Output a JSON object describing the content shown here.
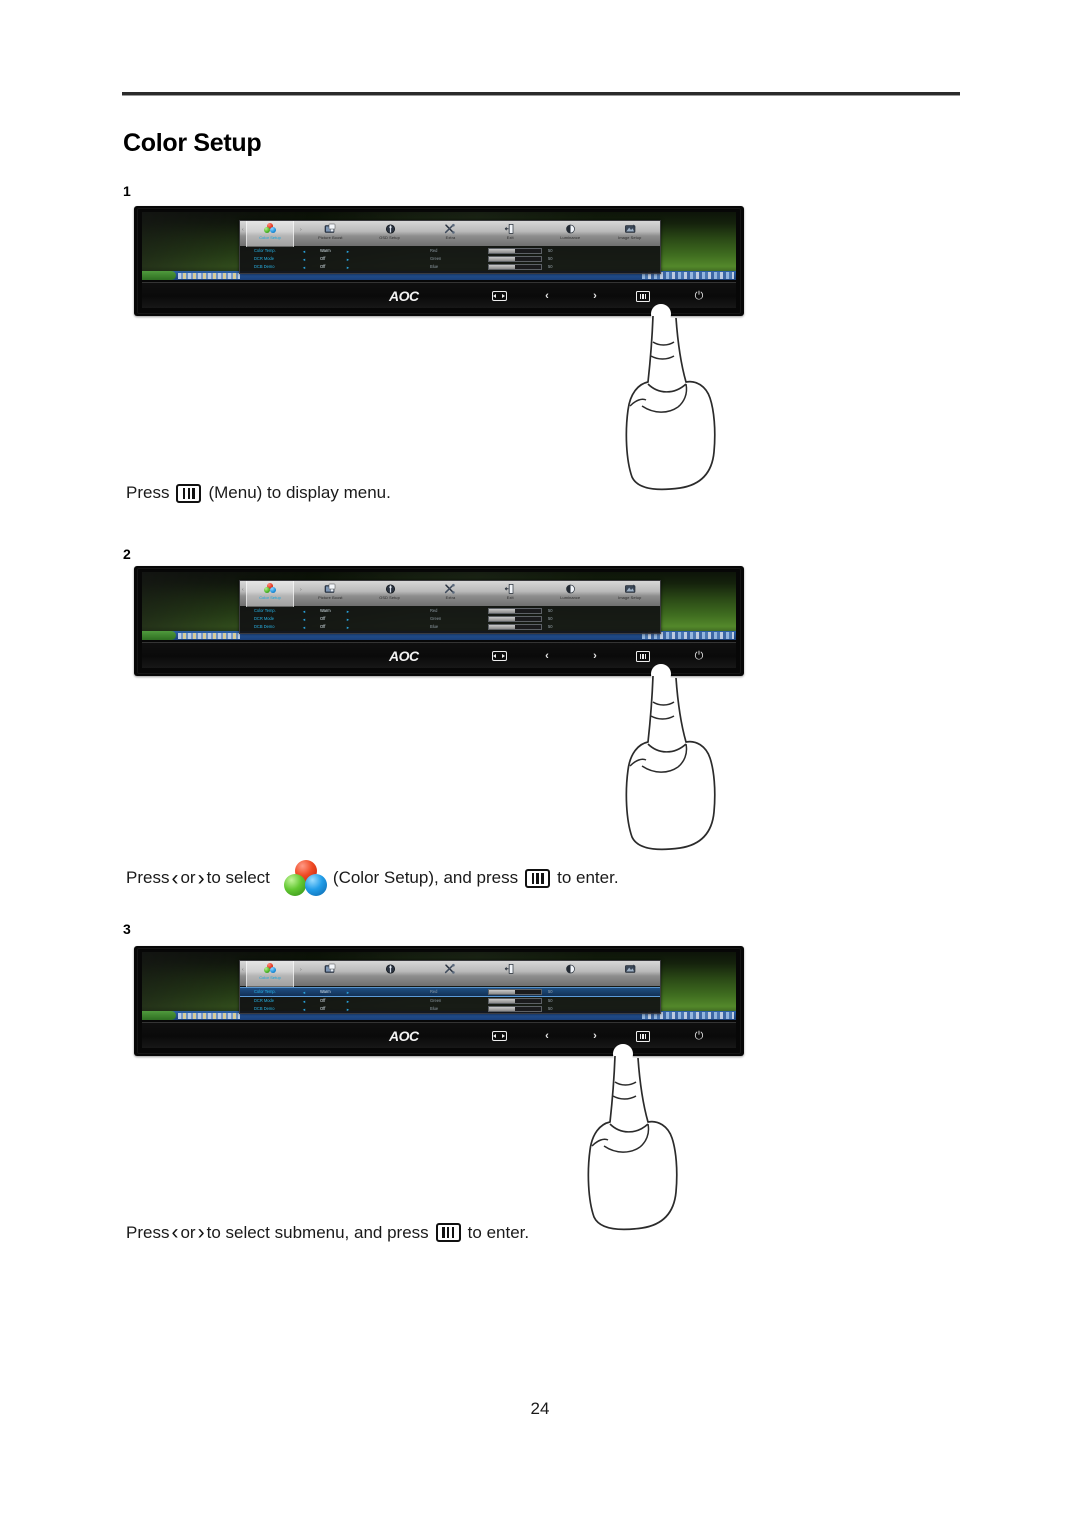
{
  "document": {
    "section_title": "Color Setup",
    "page_number": "24"
  },
  "steps": [
    {
      "number": "1"
    },
    {
      "number": "2"
    },
    {
      "number": "3"
    }
  ],
  "captions": {
    "step1": {
      "press": "Press",
      "menu_paren": "(Menu) to display menu."
    },
    "step2": {
      "press": "Press",
      "or": "or",
      "to_select": "to select",
      "target": "(Color Setup), and press",
      "to_enter": "to enter.",
      "chev_left": "‹",
      "chev_right": "›"
    },
    "step3": {
      "press": "Press",
      "or": "or",
      "to_select": "to select submenu, and press",
      "to_enter": "to enter.",
      "chev_left": "‹",
      "chev_right": "›"
    }
  },
  "osd": {
    "tabs": [
      {
        "label": "Color Setup",
        "icon": "color-spheres-icon",
        "active": true
      },
      {
        "label": "Picture Boost",
        "icon": "picture-boost-icon",
        "active": false
      },
      {
        "label": "OSD Setup",
        "icon": "osd-setup-icon",
        "active": false
      },
      {
        "label": "Extra",
        "icon": "extra-tools-icon",
        "active": false
      },
      {
        "label": "Exit",
        "icon": "exit-door-icon",
        "active": false
      },
      {
        "label": "Luminance",
        "icon": "luminance-icon",
        "active": false
      },
      {
        "label": "Image Setup",
        "icon": "image-setup-icon",
        "active": false
      }
    ],
    "nav_arrow_left": "‹",
    "nav_arrow_right": "›",
    "rows": [
      {
        "name": "Color Temp.",
        "value": "Warm",
        "arrow_left": "◄",
        "arrow_right": "►",
        "channel": "Red",
        "level": "50",
        "fill_pct": 50
      },
      {
        "name": "DCR Mode",
        "value": "Off",
        "arrow_left": "◄",
        "arrow_right": "►",
        "channel": "Green",
        "level": "50",
        "fill_pct": 50
      },
      {
        "name": "DCB Demo",
        "value": "Off",
        "arrow_left": "◄",
        "arrow_right": "►",
        "channel": "Blue",
        "level": "50",
        "fill_pct": 50
      }
    ]
  },
  "monitor": {
    "brand": "AOC",
    "buttons": [
      {
        "name": "source-button",
        "icon": "source-input-icon",
        "glyph": ""
      },
      {
        "name": "left-button",
        "icon": "chevron-left-icon",
        "glyph": "‹"
      },
      {
        "name": "right-button",
        "icon": "chevron-right-icon",
        "glyph": "›"
      },
      {
        "name": "menu-button",
        "icon": "menu-icon",
        "glyph": ""
      },
      {
        "name": "power-button",
        "icon": "power-icon",
        "glyph": "⏻"
      }
    ]
  },
  "figures": [
    {
      "id": "figure-1",
      "selected_row": -1,
      "finger_target": "menu-button"
    },
    {
      "id": "figure-2",
      "selected_row": -1,
      "finger_target": "menu-button"
    },
    {
      "id": "figure-3",
      "selected_row": 0,
      "finger_target": "right-button"
    }
  ],
  "colors": {
    "osd_accent": "#28b4e8",
    "sphere_red": "#ef4a24",
    "sphere_green": "#63c832",
    "sphere_blue": "#229de8",
    "screen_green": "#3e6b1f"
  }
}
